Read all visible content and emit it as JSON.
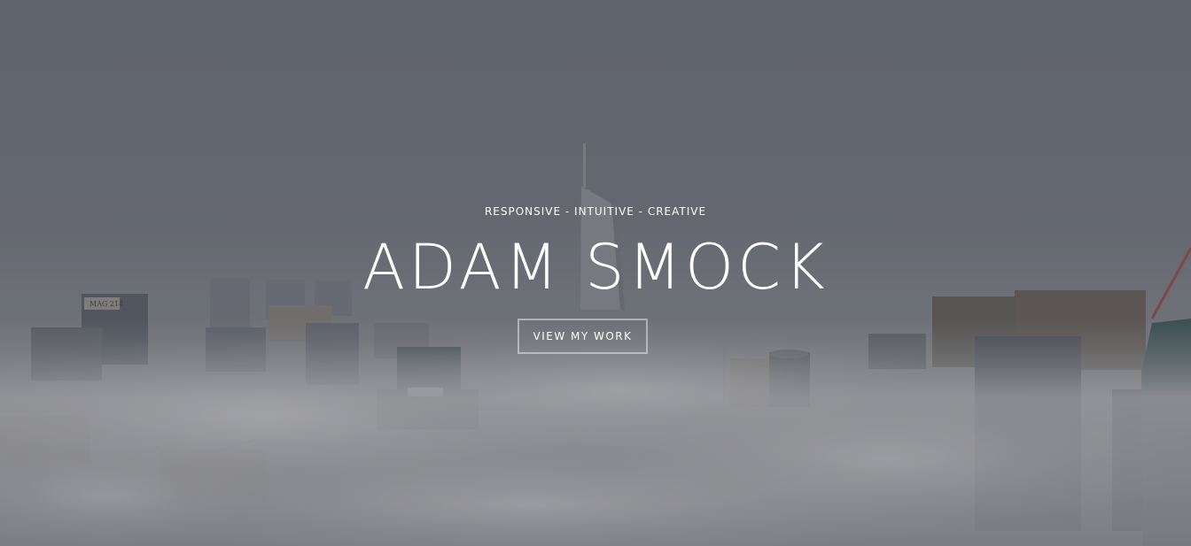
{
  "hero": {
    "tagline": "RESPONSIVE - INTUITIVE - CREATIVE",
    "name": "ADAM SMOCK",
    "cta_label": "VIEW MY WORK",
    "building_sign": "MAG 214"
  },
  "colors": {
    "overlay": "#6b7079",
    "text": "#ffffff",
    "fog": "#b9b9bb",
    "building_dark": "#4a4f57",
    "building_mid": "#6e6a66"
  }
}
